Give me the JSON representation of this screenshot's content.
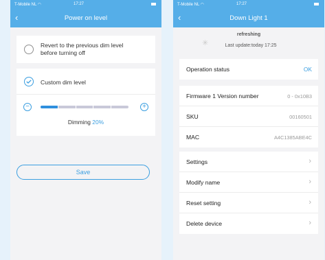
{
  "status_bar": {
    "carrier": "T-Mobile NL",
    "time": "17:27"
  },
  "left_screen": {
    "nav_title": "Power on level",
    "options": [
      {
        "label_lines": [
          "Revert to the previous dim level",
          "before turning off"
        ],
        "selected": false
      },
      {
        "label_lines": [
          "Custom dim level"
        ],
        "selected": true
      }
    ],
    "dimming": {
      "label": "Dimming",
      "value_text": "20%",
      "level": 0.2
    },
    "save_label": "Save"
  },
  "right_screen": {
    "nav_title": "Down Light 1",
    "refresh_status": "refreshing",
    "last_update": "Last update:today 17:25",
    "operation_status": {
      "label": "Operation status",
      "value": "OK"
    },
    "device_info": [
      {
        "label": "Firmware 1 Version number",
        "value": "0 - 0x10B3"
      },
      {
        "label": "SKU",
        "value": "00160501"
      },
      {
        "label": "MAC",
        "value": "A4C1385ABE4C"
      }
    ],
    "menu": [
      {
        "label": "Settings"
      },
      {
        "label": "Modify name"
      },
      {
        "label": "Reset setting"
      },
      {
        "label": "Delete device"
      }
    ]
  },
  "colors": {
    "nav_blue": "#55aee8",
    "accent": "#3a9ee0",
    "background": "#e6f2fb"
  },
  "icons": [
    "wifi-icon",
    "back-chevron-icon",
    "checkmark-icon",
    "minus-icon",
    "plus-icon",
    "spinner-icon",
    "chevron-right-icon"
  ]
}
